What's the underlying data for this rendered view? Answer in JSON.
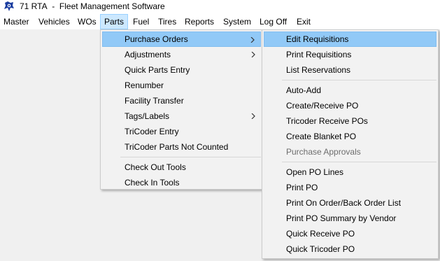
{
  "title": {
    "app": "71 RTA",
    "separator": "-",
    "name": "Fleet Management Software"
  },
  "menubar": {
    "items": [
      "Master",
      "Vehicles",
      "WOs",
      "Parts",
      "Fuel",
      "Tires",
      "Reports",
      "System",
      "Log Off",
      "Exit"
    ],
    "open_item": "Parts"
  },
  "parts_menu": {
    "items": [
      {
        "label": "Purchase Orders",
        "has_submenu": true,
        "highlighted": true
      },
      {
        "label": "Adjustments",
        "has_submenu": true
      },
      {
        "label": "Quick Parts Entry"
      },
      {
        "label": "Renumber"
      },
      {
        "label": "Facility Transfer"
      },
      {
        "label": "Tags/Labels",
        "has_submenu": true
      },
      {
        "label": "TriCoder Entry"
      },
      {
        "label": "TriCoder Parts Not Counted"
      },
      {
        "label": "Check Out Tools"
      },
      {
        "label": "Check In Tools"
      }
    ]
  },
  "purchase_orders_submenu": {
    "items": [
      {
        "label": "Edit Requisitions",
        "highlighted": true
      },
      {
        "label": "Print Requisitions"
      },
      {
        "label": "List Reservations"
      },
      {
        "label": "Auto-Add"
      },
      {
        "label": "Create/Receive PO"
      },
      {
        "label": "Tricoder Receive POs"
      },
      {
        "label": "Create Blanket PO"
      },
      {
        "label": "Purchase Approvals",
        "disabled": true
      },
      {
        "label": "Open PO Lines"
      },
      {
        "label": "Print PO"
      },
      {
        "label": "Print On Order/Back Order List"
      },
      {
        "label": "Print PO Summary by Vendor"
      },
      {
        "label": "Quick Receive PO"
      },
      {
        "label": "Quick Tricoder PO"
      }
    ]
  },
  "colors": {
    "highlight": "#91c9f7",
    "menubar_open": "#cce8ff",
    "disabled_text": "#6d6d6d"
  }
}
